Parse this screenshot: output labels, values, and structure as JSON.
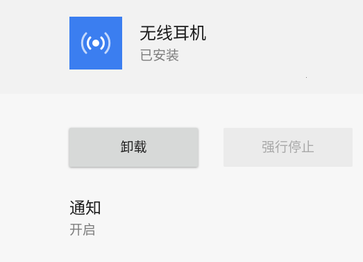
{
  "app": {
    "name": "无线耳机",
    "status": "已安装",
    "icon": "wireless-broadcast-icon",
    "icon_color": "#3b7ef0"
  },
  "actions": {
    "uninstall_label": "卸载",
    "force_stop_label": "强行停止"
  },
  "notifications": {
    "title": "通知",
    "value": "开启"
  }
}
